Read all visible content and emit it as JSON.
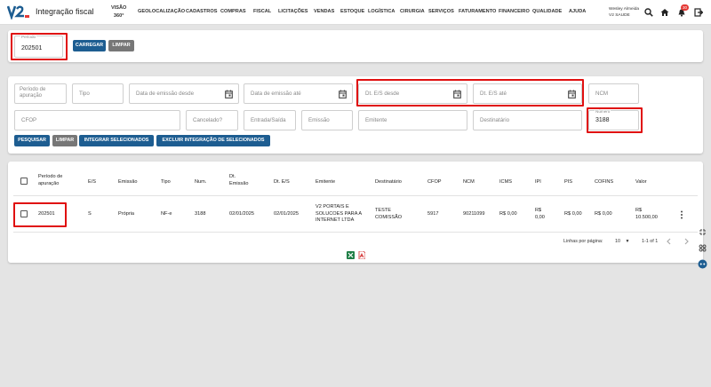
{
  "app": {
    "title": "Integração fiscal"
  },
  "nav": {
    "visao_line1": "VISÃO",
    "visao_line2": "360°",
    "items": [
      "GEOLOCALIZAÇÃO",
      "CADASTROS",
      "COMPRAS",
      "FISCAL",
      "LICITAÇÕES",
      "VENDAS",
      "ESTOQUE",
      "LOGÍSTICA",
      "CIRURGIA",
      "SERVIÇOS",
      "FATURAMENTO",
      "FINANCEIRO",
      "QUALIDADE",
      "AJUDA"
    ]
  },
  "user": {
    "name": "Wesley Almeida",
    "company": "V2 SAUDE",
    "notification_count": "30"
  },
  "top_form": {
    "periodo_label": "Período",
    "periodo_value": "202501",
    "carregar_label": "CARREGAR",
    "limpar_label": "LIMPAR"
  },
  "filters": {
    "periodo_apuracao": "Período de apuração",
    "tipo": "Tipo",
    "data_emissao_desde": "Data de emissão desde",
    "data_emissao_ate": "Data de emissão até",
    "dt_es_desde": "Dt. E/S desde",
    "dt_es_ate": "Dt. E/S até",
    "ncm": "NCM",
    "cfop": "CFOP",
    "cancelado": "Cancelado?",
    "entrada_saida": "Entrada/Saída",
    "emissao": "Emissão",
    "emitente": "Emitente",
    "destinatario": "Destinatário",
    "numero_label": "Número",
    "numero_value": "3188",
    "pesquisar_label": "PESQUISAR",
    "limpar_label": "LIMPAR",
    "integrar_label": "INTEGRAR SELECIONADOS",
    "excluir_label": "EXCLUIR INTEGRAÇÃO DE SELECIONADOS"
  },
  "table": {
    "headers": {
      "periodo_line1": "Período de",
      "periodo_line2": "apuração",
      "es": "E/S",
      "emissao": "Emissão",
      "tipo": "Tipo",
      "num": "Num.",
      "dt_emissao_line1": "Dt.",
      "dt_emissao_line2": "Emissão",
      "dt_es": "Dt. E/S",
      "emitente": "Emitente",
      "destinatario": "Destinatário",
      "cfop": "CFOP",
      "ncm": "NCM",
      "icms": "ICMS",
      "ipi": "IPI",
      "pis": "PIS",
      "cofins": "COFINS",
      "valor": "Valor"
    },
    "rows": [
      {
        "periodo": "202501",
        "es": "S",
        "emissao": "Própria",
        "tipo": "NF-e",
        "num": "3188",
        "dt_emissao": "02/01/2025",
        "dt_es": "02/01/2025",
        "emitente_lines": [
          "V2 PORTAIS E",
          "SOLUCOES PARA A",
          "INTERNET LTDA"
        ],
        "destinatario_lines": [
          "TESTE",
          "COMISSÃO"
        ],
        "cfop": "5917",
        "ncm": "90211099",
        "icms": "R$ 0,00",
        "ipi_lines": [
          "R$",
          "0,00"
        ],
        "pis": "R$ 0,00",
        "cofins": "R$ 0,00",
        "valor_lines": [
          "R$",
          "10.500,00"
        ]
      }
    ]
  },
  "pagination": {
    "rows_per_page_label": "Linhas por página:",
    "rows_per_page_value": "10",
    "range": "1-1 of 1"
  },
  "colors": {
    "accent": "#1d5d91",
    "highlight": "#e01010",
    "badge": "#e53935"
  }
}
